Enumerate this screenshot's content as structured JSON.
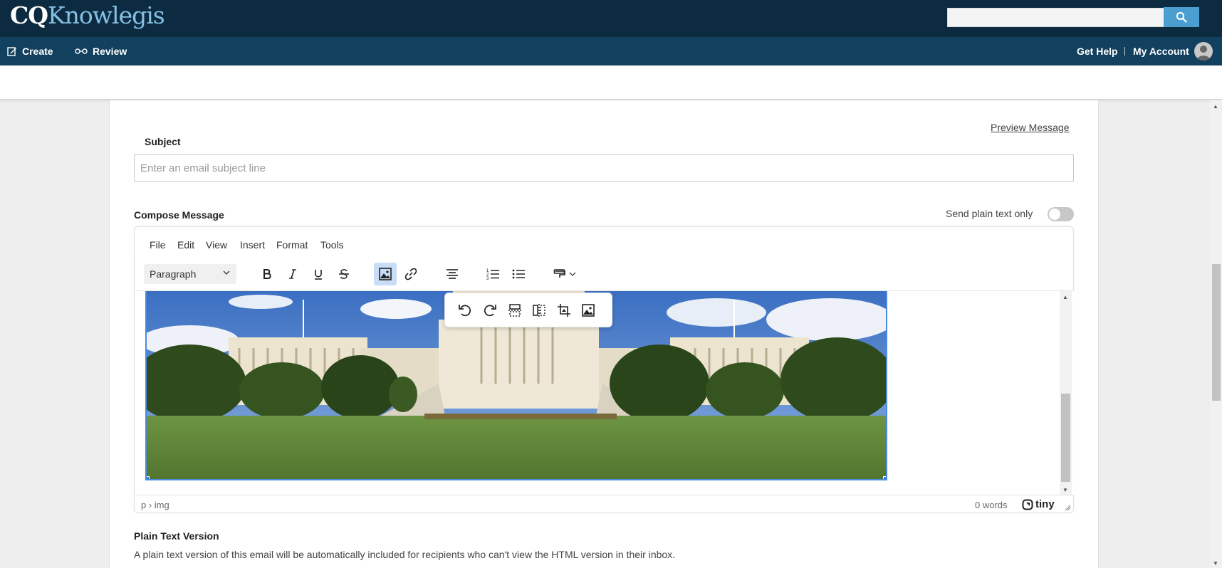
{
  "header": {
    "logo_cq": "CQ",
    "logo_knowlegis": "Knowlegis",
    "search_placeholder": "",
    "search_icon": "search-icon"
  },
  "nav": {
    "create_label": "Create",
    "review_label": "Review",
    "help_label": "Get Help",
    "account_label": "My Account"
  },
  "compose": {
    "preview_link": "Preview Message",
    "subject_label": "Subject",
    "subject_placeholder": "Enter an email subject line",
    "subject_value": "",
    "compose_label": "Compose Message",
    "plain_toggle_label": "Send plain text only",
    "plain_toggle_on": false
  },
  "editor": {
    "menus": [
      "File",
      "Edit",
      "View",
      "Insert",
      "Format",
      "Tools"
    ],
    "block_format": "Paragraph",
    "toolbar_icons": [
      "bold-icon",
      "italic-icon",
      "underline-icon",
      "strikethrough-icon",
      "image-icon",
      "link-icon",
      "align-center-icon",
      "numbered-list-icon",
      "bullet-list-icon",
      "format-painter-icon"
    ],
    "image_toolbar_icons": [
      "rotate-left-icon",
      "rotate-right-icon",
      "flip-vertical-icon",
      "flip-horizontal-icon",
      "crop-icon",
      "image-options-icon"
    ],
    "status_path": "p › img",
    "word_count": "0 words",
    "brand": "tiny"
  },
  "plain_text": {
    "title": "Plain Text Version",
    "description": "A plain text version of this email will be automatically included for recipients who can't view the HTML version in their inbox."
  },
  "colors": {
    "topbar": "#0d2b40",
    "navbar": "#12405f",
    "accent": "#4a9fd0",
    "selection": "#4a8ae0"
  }
}
